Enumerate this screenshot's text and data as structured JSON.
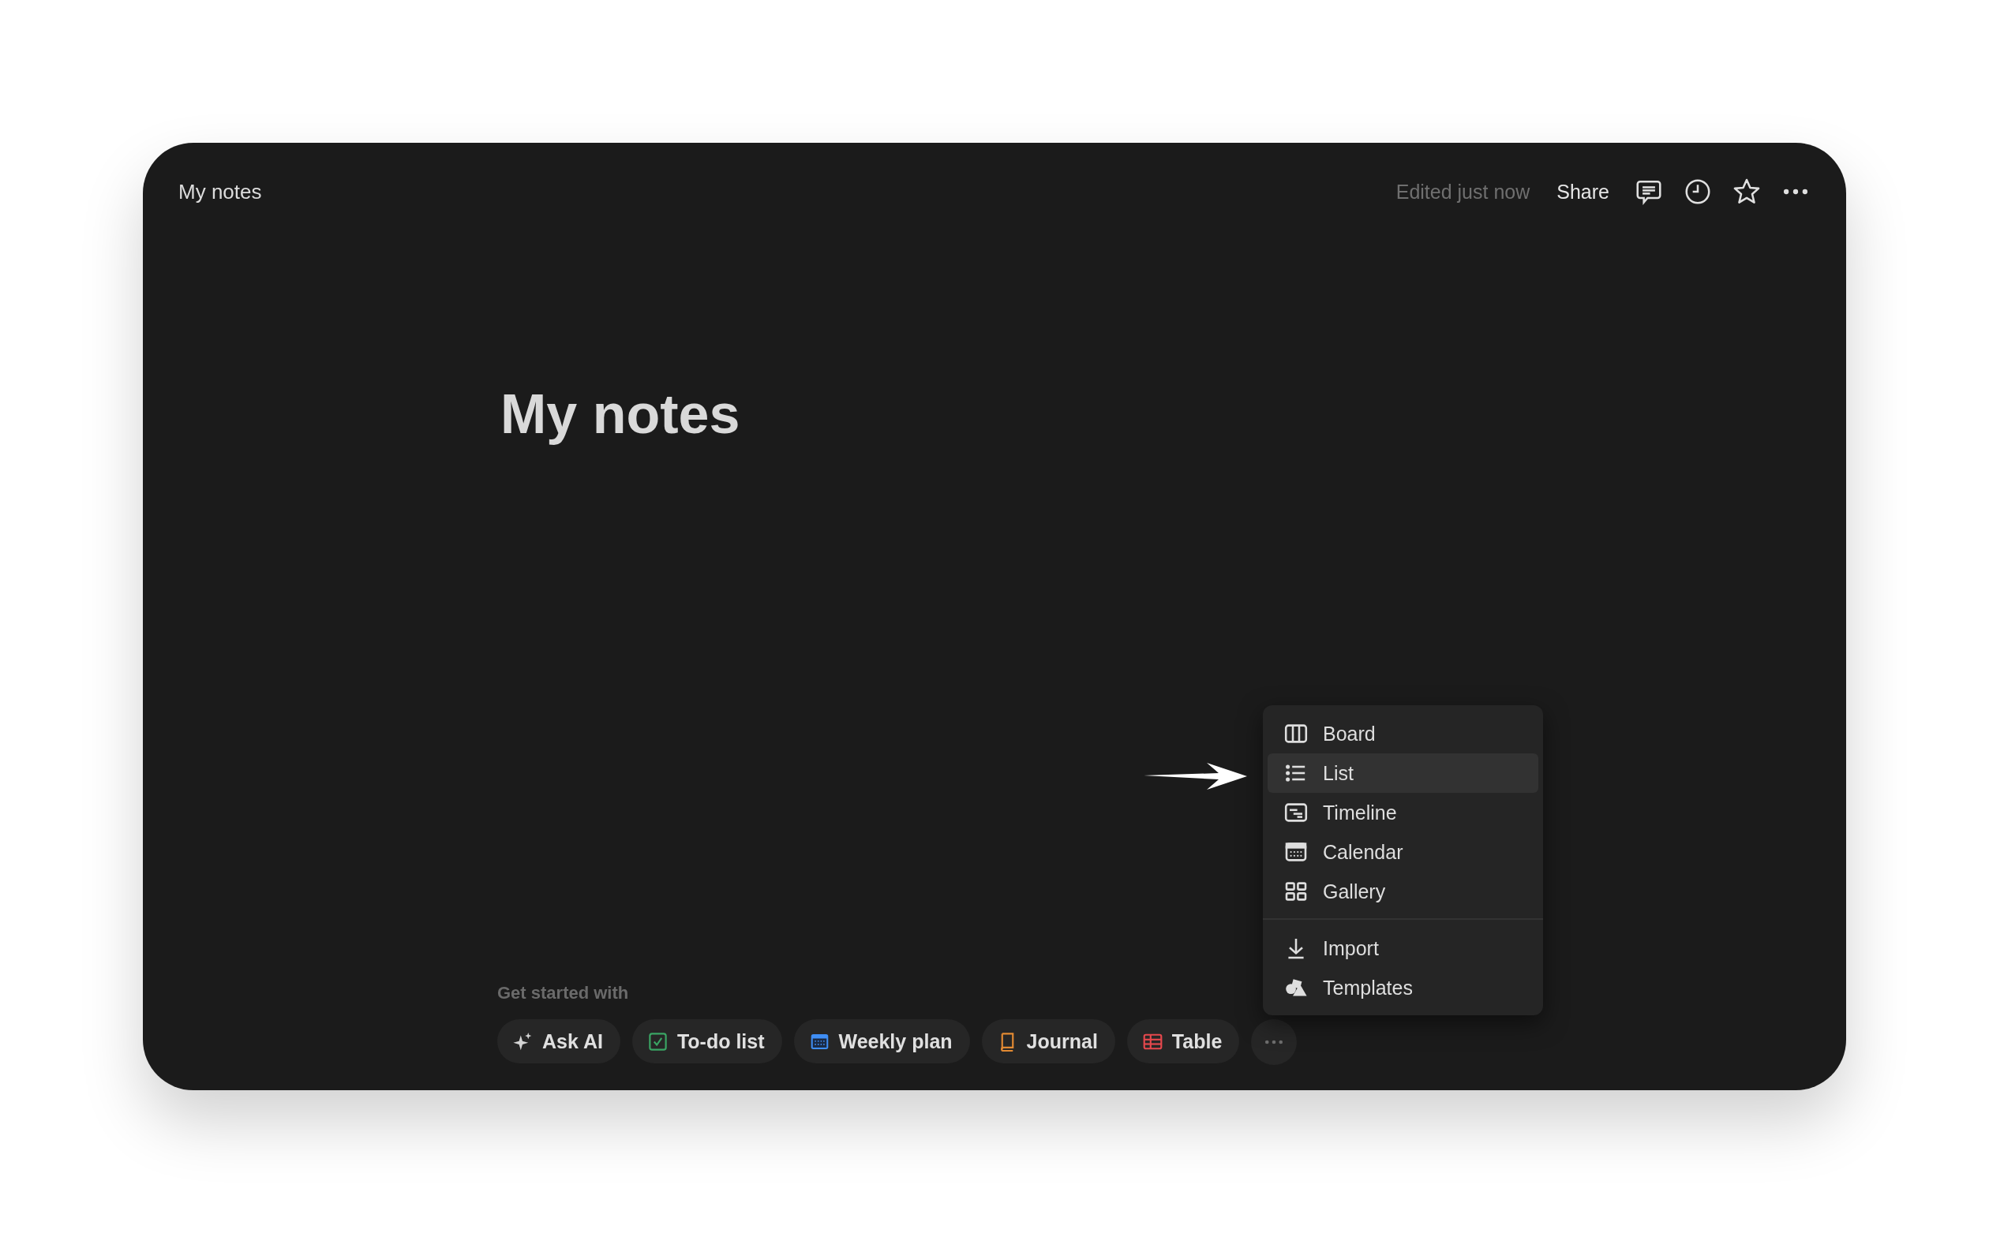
{
  "window": {
    "title": "My notes"
  },
  "header": {
    "status": "Edited just now",
    "share": "Share"
  },
  "page": {
    "title": "My notes"
  },
  "menu": {
    "groups": [
      [
        {
          "label": "Board",
          "kind": "board",
          "selected": false
        },
        {
          "label": "List",
          "kind": "list",
          "selected": true
        },
        {
          "label": "Timeline",
          "kind": "timeline",
          "selected": false
        },
        {
          "label": "Calendar",
          "kind": "calendar",
          "selected": false
        },
        {
          "label": "Gallery",
          "kind": "gallery",
          "selected": false
        }
      ],
      [
        {
          "label": "Import",
          "kind": "import",
          "selected": false
        },
        {
          "label": "Templates",
          "kind": "templates",
          "selected": false
        }
      ]
    ]
  },
  "get_started": {
    "label": "Get started with",
    "chips": [
      {
        "label": "Ask AI",
        "kind": "ai"
      },
      {
        "label": "To-do list",
        "kind": "todo"
      },
      {
        "label": "Weekly plan",
        "kind": "calendar"
      },
      {
        "label": "Journal",
        "kind": "journal"
      },
      {
        "label": "Table",
        "kind": "table"
      }
    ]
  }
}
